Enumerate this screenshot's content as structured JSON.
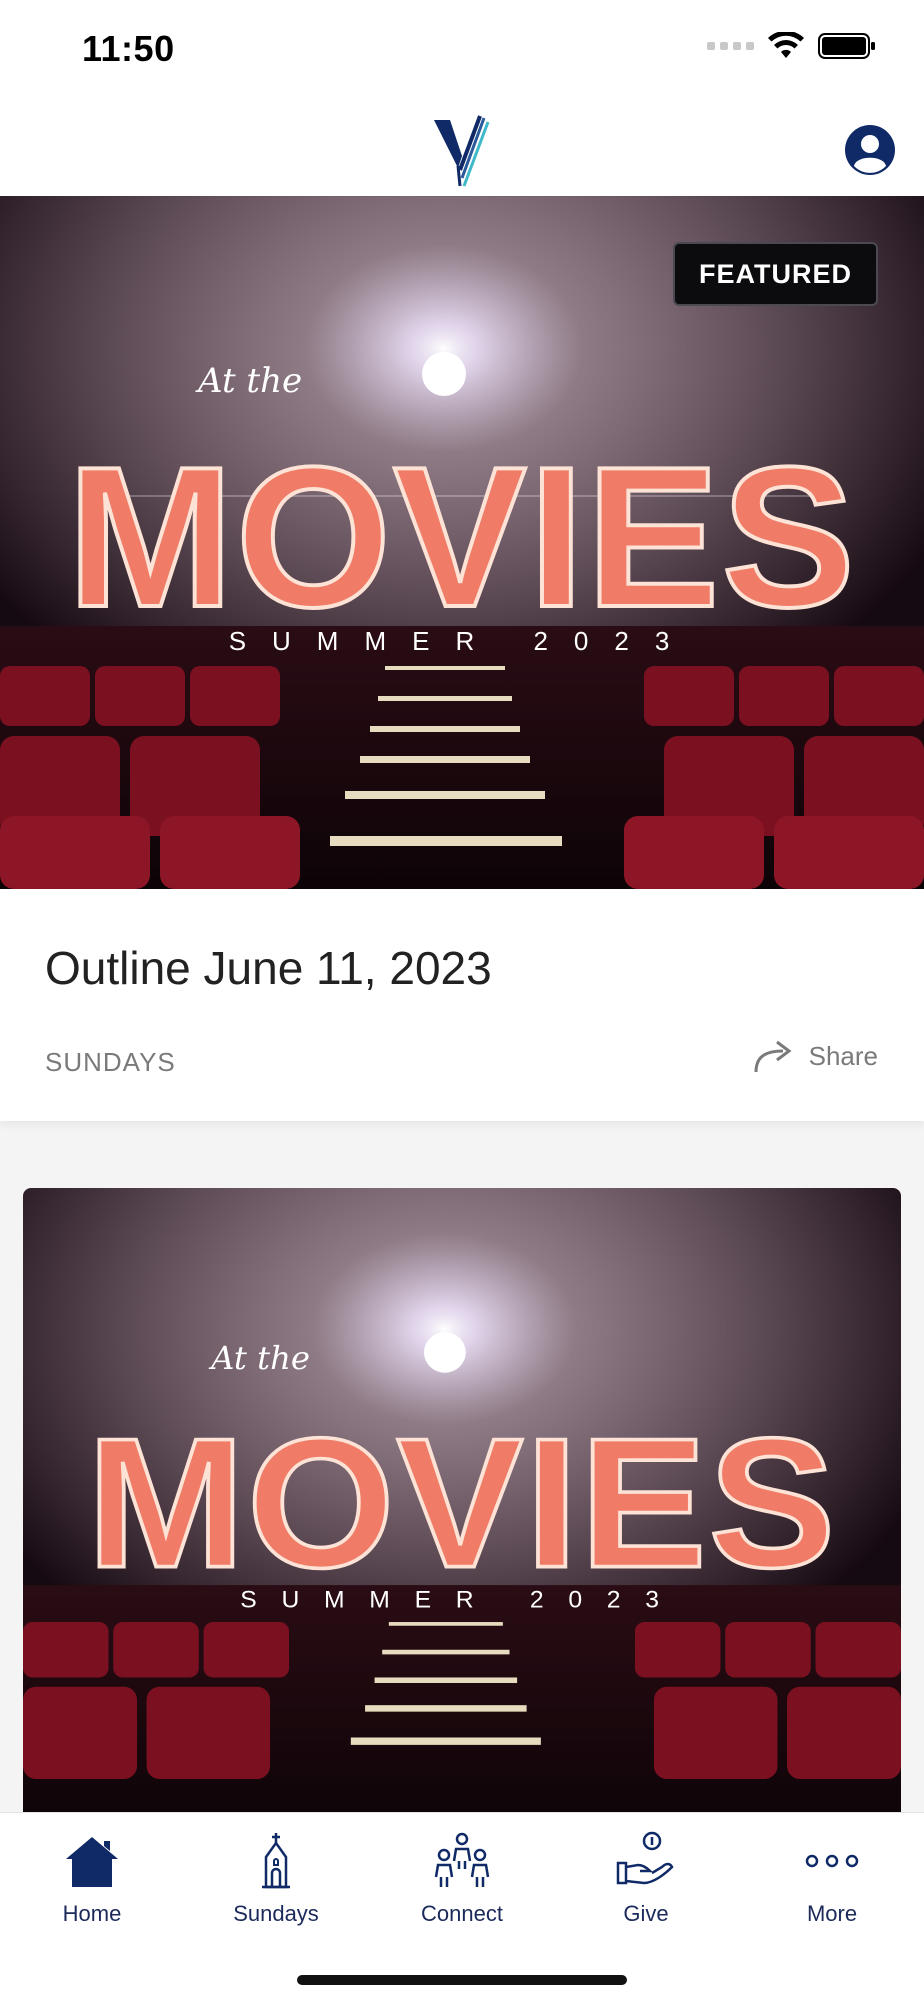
{
  "status_bar": {
    "time": "11:50"
  },
  "header": {
    "logo_icon": "brand-y-logo-icon",
    "profile_icon": "user-profile-icon"
  },
  "featured": {
    "badge": "FEATURED",
    "art": {
      "line1": "At the",
      "line2": "MOVIES",
      "line3": "SUMMER 2023"
    },
    "title": "Outline June 11, 2023",
    "category": "SUNDAYS",
    "share_label": "Share"
  },
  "card": {
    "art": {
      "line1": "At the",
      "line2": "MOVIES",
      "line3": "SUMMER 2023"
    }
  },
  "tabs": [
    {
      "label": "Home",
      "icon": "home-icon",
      "active": true
    },
    {
      "label": "Sundays",
      "icon": "church-icon",
      "active": false
    },
    {
      "label": "Connect",
      "icon": "people-group-icon",
      "active": false
    },
    {
      "label": "Give",
      "icon": "hand-giving-icon",
      "active": false
    },
    {
      "label": "More",
      "icon": "more-dots-icon",
      "active": false
    }
  ],
  "colors": {
    "brand_navy": "#0f2a66",
    "accent_teal": "#3fb9c9",
    "seat_red": "#7a1020",
    "bulb": "#f07b66"
  }
}
